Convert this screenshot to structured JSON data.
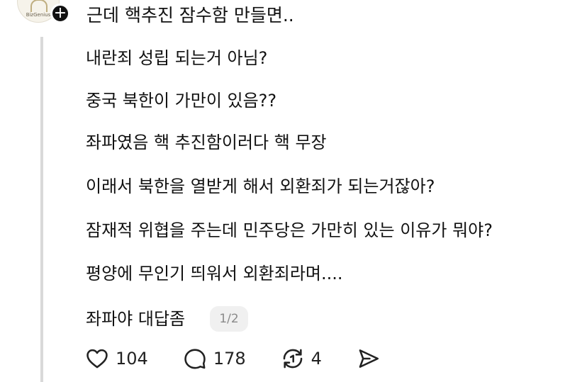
{
  "post": {
    "avatar_brand": "BizGenius",
    "first_line": "근데 핵추진 잠수함 만들면..",
    "lines": [
      "내란죄 성립 되는거 아님?",
      "중국 북한이 가만이 있음??",
      "좌파였음 핵 추진함이러다 핵 무장",
      "이래서 북한을 열받게 해서 외환죄가 되는거잖아?",
      "잠재적 위협을 주는데 민주당은 가만히 있는 이유가 뭐야?",
      "평양에 무인기 띄워서 외환죄라며....",
      "좌파야 대답좀"
    ],
    "page_indicator": "1/2"
  },
  "actions": {
    "like_count": "104",
    "comment_count": "178",
    "repost_count": "4"
  },
  "icons": {
    "follow": "plus-icon",
    "like": "heart-icon",
    "comment": "comment-bubble-icon",
    "repost": "repost-icon",
    "share": "send-icon"
  }
}
